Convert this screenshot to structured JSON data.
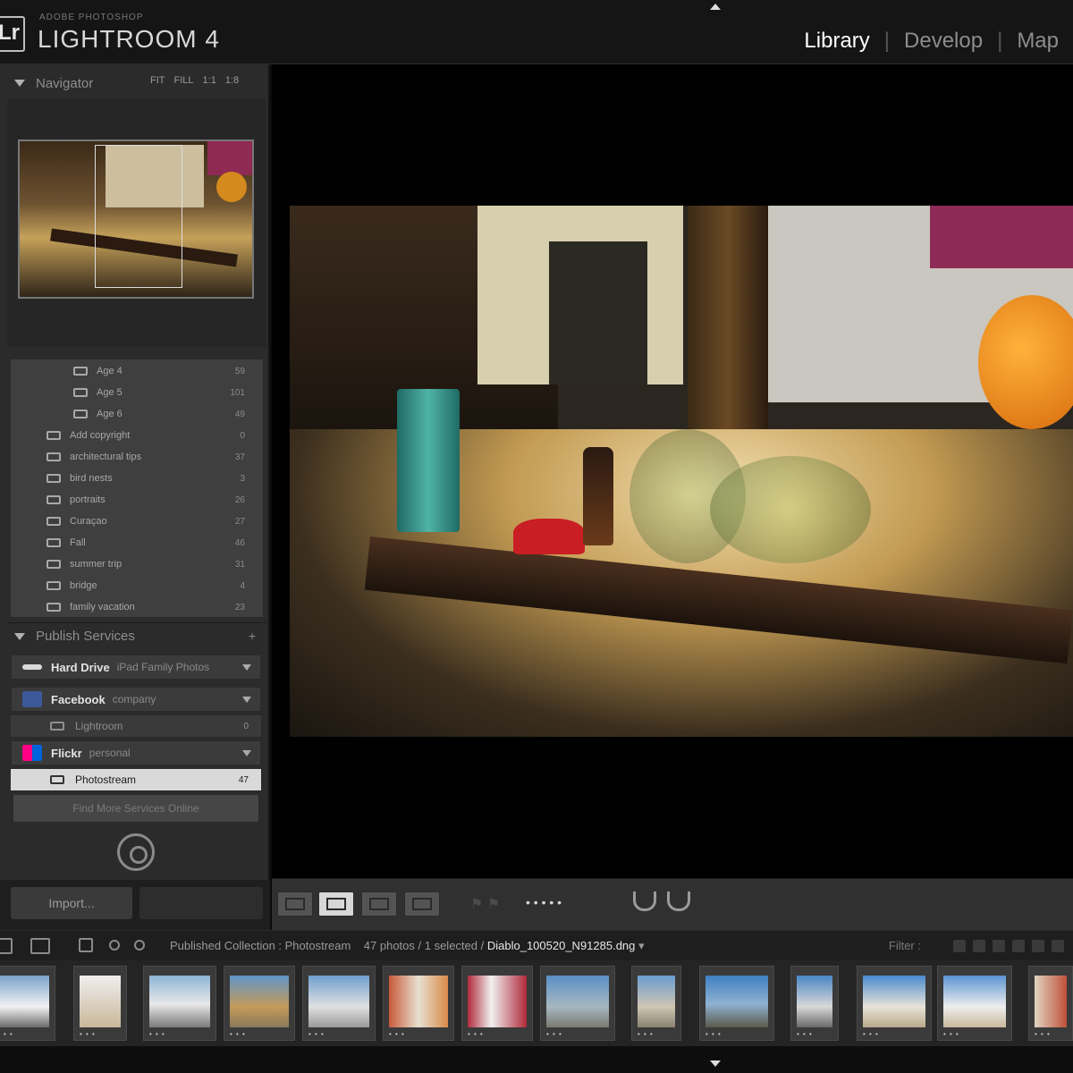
{
  "header": {
    "logo_text": "Lr",
    "product_small": "ADOBE PHOTOSHOP",
    "product_name": "LIGHTROOM 4",
    "modules": [
      {
        "label": "Library",
        "active": true
      },
      {
        "label": "Develop",
        "active": false
      },
      {
        "label": "Map",
        "active": false
      }
    ]
  },
  "navigator": {
    "title": "Navigator",
    "zoom_options": [
      "FIT",
      "FILL",
      "1:1",
      "1:8"
    ]
  },
  "collections": [
    {
      "label": "Age 4",
      "count": "59"
    },
    {
      "label": "Age 5",
      "count": "101"
    },
    {
      "label": "Age 6",
      "count": "49"
    },
    {
      "label": "Add copyright",
      "count": "0"
    },
    {
      "label": "architectural tips",
      "count": "37"
    },
    {
      "label": "bird nests",
      "count": "3"
    },
    {
      "label": "portraits",
      "count": "26"
    },
    {
      "label": "Curaçao",
      "count": "27"
    },
    {
      "label": "Fall",
      "count": "46"
    },
    {
      "label": "summer trip",
      "count": "31"
    },
    {
      "label": "bridge",
      "count": "4"
    },
    {
      "label": "family vacation",
      "count": "23"
    }
  ],
  "publish_services": {
    "title": "Publish Services",
    "services": [
      {
        "icon": "hard-drive-icon",
        "name": "Hard Drive",
        "sub": "iPad Family Photos"
      },
      {
        "icon": "facebook-icon",
        "name": "Facebook",
        "sub": "company"
      },
      {
        "icon": "flickr-icon",
        "name": "Flickr",
        "sub": "personal"
      }
    ],
    "facebook_sub": {
      "label": "Lightroom",
      "count": "0"
    },
    "flickr_sub": {
      "label": "Photostream",
      "count": "47"
    },
    "find_more": "Find More Services Online"
  },
  "left_buttons": {
    "import": "Import..."
  },
  "toolbar": {
    "view_modes": [
      "grid-view-icon",
      "loupe-view-icon",
      "compare-view-icon",
      "survey-view-icon"
    ],
    "active_view": "loupe-view-icon",
    "rating_dots": "• • • • •"
  },
  "filmstrip": {
    "source": "Published Collection : Photostream",
    "count_text": "47 photos / 1 selected /",
    "filename": "Diablo_100520_N91285.dng",
    "filter_label": "Filter :",
    "thumb_stars": "• • •"
  },
  "colors": {
    "accent_facebook": "#3b5998",
    "accent_flickr_pink": "#ff0084",
    "accent_flickr_blue": "#0063dc",
    "panel_bg": "#2b2b2b",
    "selected_row": "#d9d9d9"
  }
}
